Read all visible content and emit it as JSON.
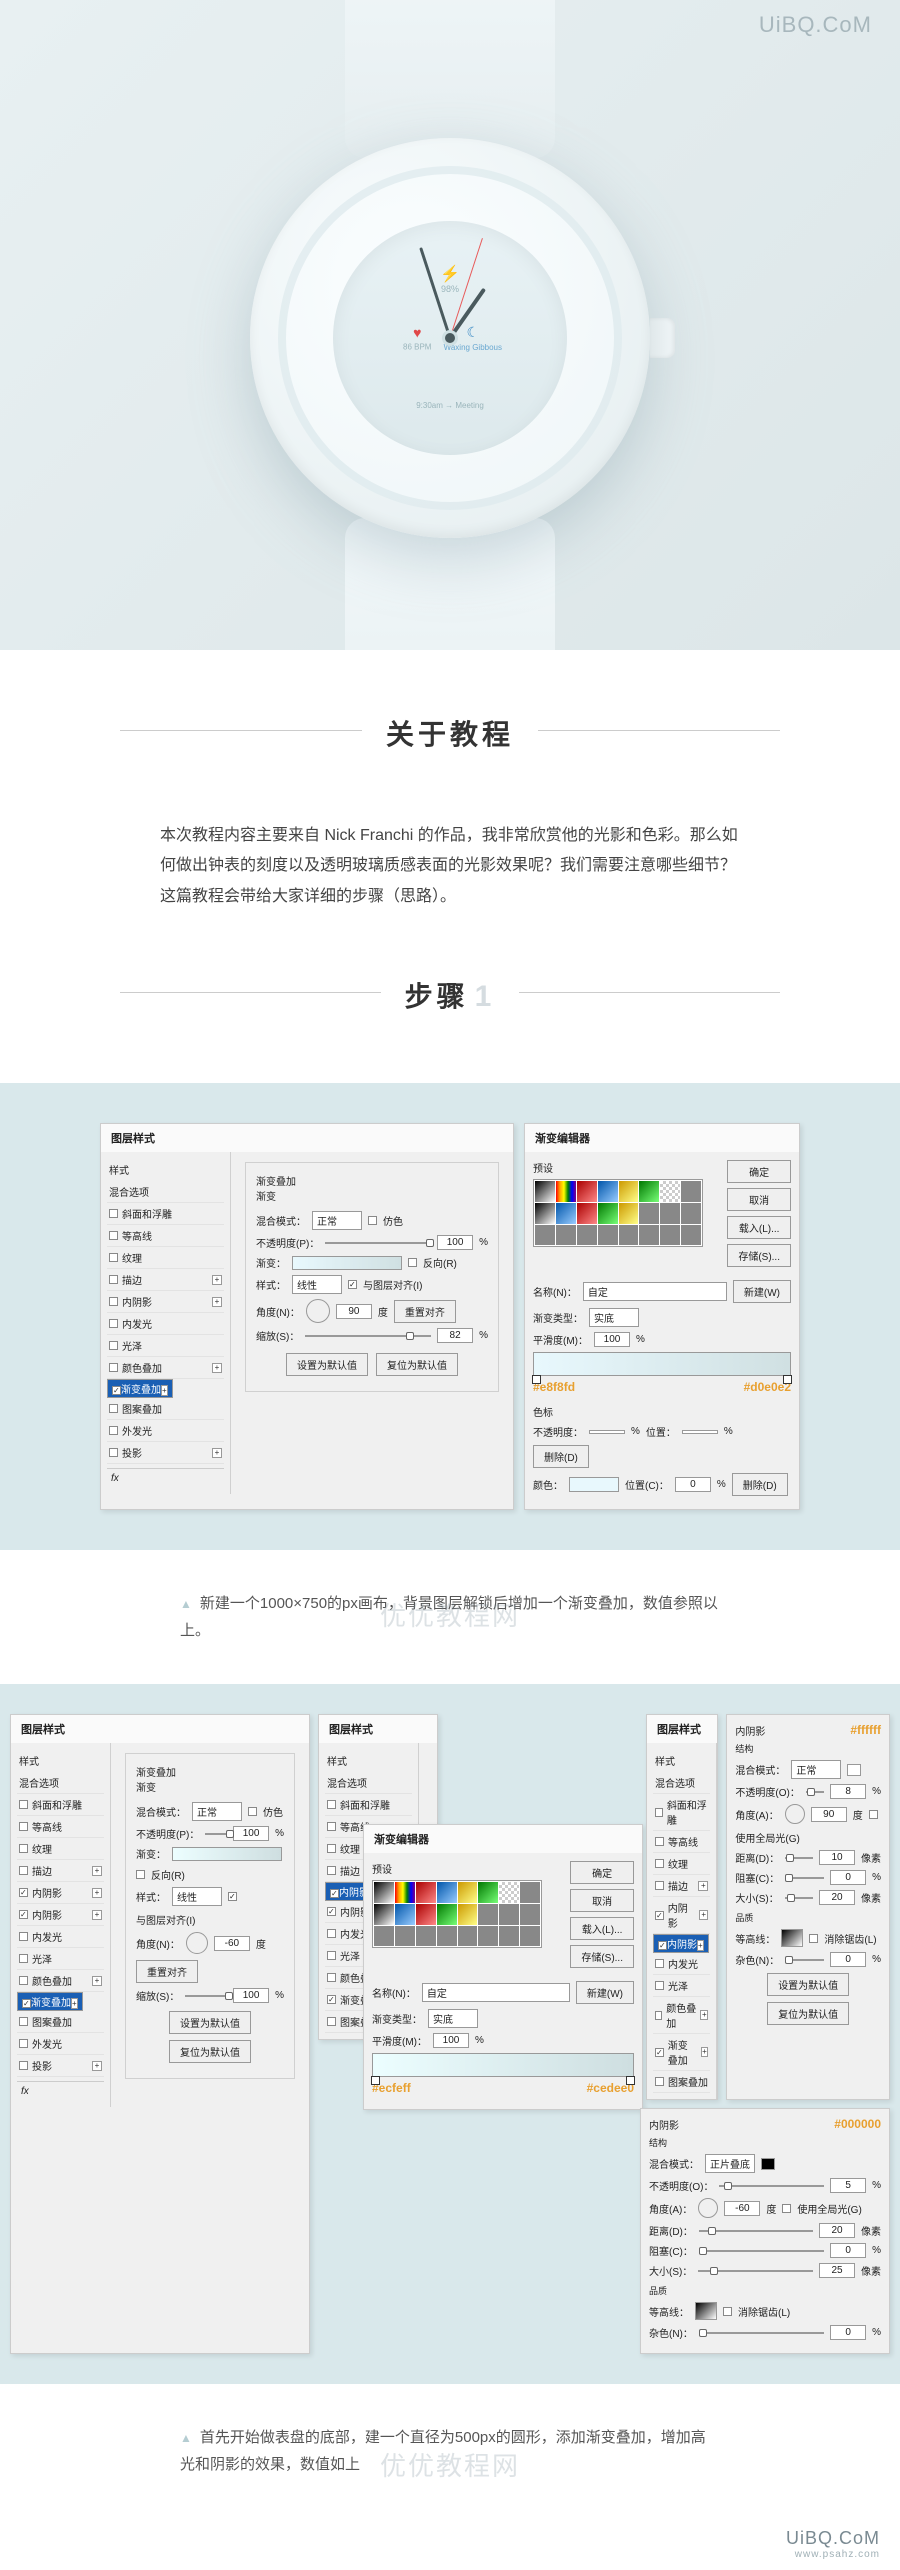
{
  "watermarks": {
    "top_right": "UiBQ.CoM",
    "center_net": "优优教程网",
    "bottom_main": "UiBQ.CoM",
    "bottom_sub": "www.psahz.com"
  },
  "hero": {
    "battery_pct": "98%",
    "bpm": "86 BPM",
    "moon_phase": "Waxing Gibbous",
    "meeting": "9:30am  →  Meeting"
  },
  "sections": {
    "about_title": "关于教程",
    "about_body": "本次教程内容主要来自 Nick Franchi 的作品，我非常欣赏他的光影和色彩。那么如何做出钟表的刻度以及透明玻璃质感表面的光影效果呢？我们需要注意哪些细节？这篇教程会带给大家详细的步骤（思路）。",
    "step_title": "步骤",
    "step_num": "1"
  },
  "layerStyle": {
    "window_title": "图层样式",
    "side": {
      "header": "样式",
      "blend_options": "混合选项",
      "bevel": "斜面和浮雕",
      "contour": "等高线",
      "texture": "纹理",
      "stroke": "描边",
      "inner_shadow": "内阴影",
      "inner_glow": "内发光",
      "satin": "光泽",
      "color_overlay": "颜色叠加",
      "gradient_overlay": "渐变叠加",
      "pattern_overlay": "图案叠加",
      "outer_glow": "外发光",
      "drop_shadow": "投影",
      "fx": "fx"
    },
    "gradOverlay": {
      "group": "渐变叠加",
      "sub": "渐变",
      "blend_mode_l": "混合模式：",
      "blend_mode_v": "正常",
      "dither_l": "仿色",
      "opacity_l": "不透明度(P)：",
      "opacity_v": "100",
      "pct": "%",
      "gradient_l": "渐变：",
      "reverse_l": "反向(R)",
      "style_l": "样式：",
      "style_v": "线性",
      "align_l": "与图层对齐(I)",
      "angle_l": "角度(N)：",
      "angle_v": "90",
      "angle_v2": "-60",
      "deg": "度",
      "reset_align": "重置对齐",
      "scale_l": "缩放(S)：",
      "scale_v": "82",
      "scale_v2": "100",
      "make_default": "设置为默认值",
      "reset_default": "复位为默认值"
    },
    "innerShadow": {
      "group": "内阴影",
      "struct": "结构",
      "blend_mode_l": "混合模式：",
      "blend_mode_v": "正常",
      "blend_mode_v2": "正片叠底",
      "opacity_l": "不透明度(O)：",
      "opacity_v": "8",
      "opacity_v2": "5",
      "angle_l": "角度(A)：",
      "angle_v": "90",
      "angle_v2": "-60",
      "deg": "度",
      "global_l": "使用全局光(G)",
      "distance_l": "距离(D)：",
      "distance_v": "10",
      "distance_v2": "20",
      "px": "像素",
      "choke_l": "阻塞(C)：",
      "choke_v": "0",
      "size_l": "大小(S)：",
      "size_v": "20",
      "size_v2": "25",
      "quality": "品质",
      "contour_l": "等高线：",
      "anti_l": "消除锯齿(L)",
      "noise_l": "杂色(N)：",
      "noise_v": "0"
    }
  },
  "gradEditor": {
    "title": "渐变编辑器",
    "presets_l": "预设",
    "ok": "确定",
    "cancel": "取消",
    "load": "载入(L)...",
    "save": "存储(S)...",
    "name_l": "名称(N)：",
    "name_v": "自定",
    "new_btn": "新建(W)",
    "type_l": "渐变类型：",
    "type_v": "实底",
    "smooth_l": "平滑度(M)：",
    "smooth_v": "100",
    "pct": "%",
    "stops_l": "色标",
    "opacity_l": "不透明度：",
    "position_l": "位置：",
    "position2_l": "位置(C)：",
    "delete_l": "删除(D)",
    "color_l": "颜色："
  },
  "colors": {
    "c1a": "#e8f8fd",
    "c1b": "#d0e0e2",
    "c2a": "#ecfeff",
    "c2b": "#cedee0",
    "white": "#ffffff",
    "black": "#000000"
  },
  "captions": {
    "c1": "新建一个1000×750的px画布，背景图层解锁后增加一个渐变叠加，数值参照以上。",
    "c2": "首先开始做表盘的底部，建一个直径为500px的圆形，添加渐变叠加，增加高光和阴影的效果，数值如上"
  }
}
